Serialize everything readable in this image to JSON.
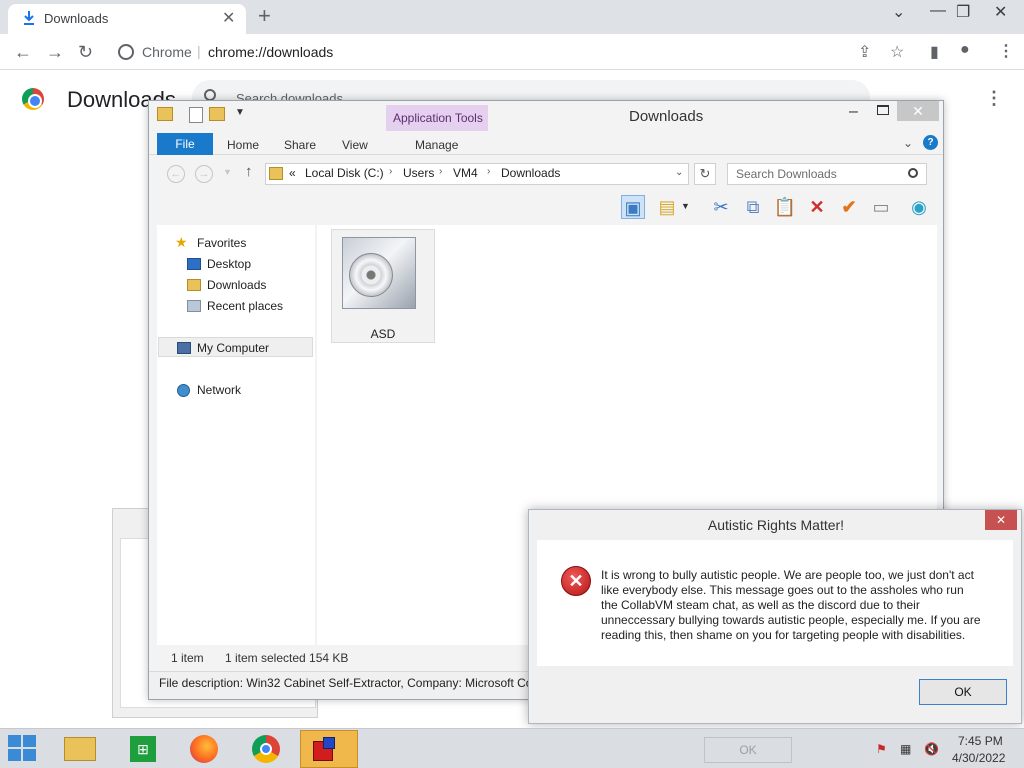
{
  "chrome": {
    "tab_title": "Downloads",
    "omnibox_site": "Chrome",
    "omnibox_url": "chrome://downloads",
    "page_heading": "Downloads",
    "search_placeholder": "Search downloads"
  },
  "explorer": {
    "window_title": "Downloads",
    "context_tab_group": "Application Tools",
    "ribbon_tabs": [
      "File",
      "Home",
      "Share",
      "View",
      "Manage"
    ],
    "address_prefix": "«",
    "breadcrumbs": [
      "Local Disk (C:)",
      "Users",
      "VM4",
      "Downloads"
    ],
    "search_placeholder": "Search Downloads",
    "nav": {
      "favorites": "Favorites",
      "desktop": "Desktop",
      "downloads": "Downloads",
      "recent": "Recent places",
      "my_computer": "My Computer",
      "network": "Network"
    },
    "file": {
      "name": "ASD",
      "icon": "installer-box-icon"
    },
    "status_count": "1 item",
    "status_selected": "1 item selected  154 KB",
    "details": "File description: Win32 Cabinet Self-Extractor, Company: Microsoft Co"
  },
  "msgbox": {
    "title": "Autistic Rights Matter!",
    "close_glyph": "✕",
    "icon": "error-icon",
    "text": "It is wrong to bully autistic people. We are people too, we just don't act like everybody else. This message goes out to the assholes who run the CollabVM steam chat, as well as the discord due to their unneccessary bullying towards autistic people, especially me. If you are reading this, then shame on you for targeting people with disabilities.",
    "ok_label": "OK"
  },
  "taskbar": {
    "ghost_ok_label": "OK",
    "time": "7:45 PM",
    "date": "4/30/2022"
  },
  "colors": {
    "file_tab": "#1979ca",
    "app_tools_band": "#e6d0ef",
    "msg_close": "#c75050",
    "error_red": "#b51515"
  }
}
